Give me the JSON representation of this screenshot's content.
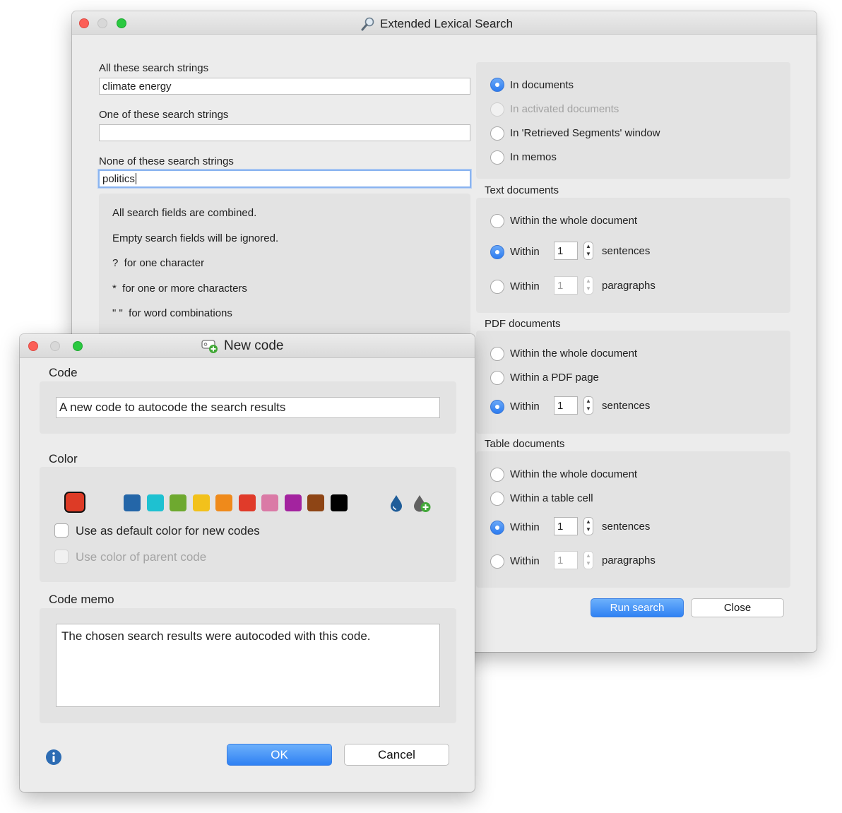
{
  "search_window": {
    "title": "Extended Lexical Search",
    "all_label": "All these search strings",
    "all_value": "climate energy",
    "one_label": "One of these search strings",
    "one_value": "",
    "none_label": "None of these search strings",
    "none_value": "politics",
    "info": [
      "All search fields are combined.",
      "Empty search fields will be ignored.",
      "?  for one character",
      "*  for one or more characters",
      "\" \"  for word combinations"
    ],
    "scope": {
      "in_documents": "In documents",
      "in_activated": "In activated documents",
      "in_retrieved": "In 'Retrieved Segments' window",
      "in_memos": "In memos"
    },
    "text_docs": {
      "title": "Text documents",
      "whole": "Within the whole document",
      "within": "Within",
      "sentences_value": "1",
      "sentences": "sentences",
      "paragraphs_value": "1",
      "paragraphs": "paragraphs"
    },
    "pdf_docs": {
      "title": "PDF documents",
      "whole": "Within the whole document",
      "page": "Within a PDF page",
      "within": "Within",
      "sentences_value": "1",
      "sentences": "sentences"
    },
    "table_docs": {
      "title": "Table documents",
      "whole": "Within the whole document",
      "cell": "Within a table cell",
      "within": "Within",
      "sentences_value": "1",
      "sentences": "sentences",
      "paragraphs_value": "1",
      "paragraphs": "paragraphs"
    },
    "run_button": "Run search",
    "close_button": "Close"
  },
  "code_window": {
    "title": "New code",
    "code_label": "Code",
    "code_value": "A new code to autocode the search results",
    "color_label": "Color",
    "selected_color": "#dd3b26",
    "palette": [
      "#2466a8",
      "#1ec1d1",
      "#6ea92f",
      "#f2c11b",
      "#ef8a1b",
      "#e03b2a",
      "#da7aa6",
      "#a3239f",
      "#8e4515",
      "#000000"
    ],
    "default_color_label": "Use as default color for new codes",
    "parent_color_label": "Use color of parent code",
    "memo_label": "Code memo",
    "memo_value": "The chosen search results were autocoded with this code.",
    "ok_button": "OK",
    "cancel_button": "Cancel"
  }
}
